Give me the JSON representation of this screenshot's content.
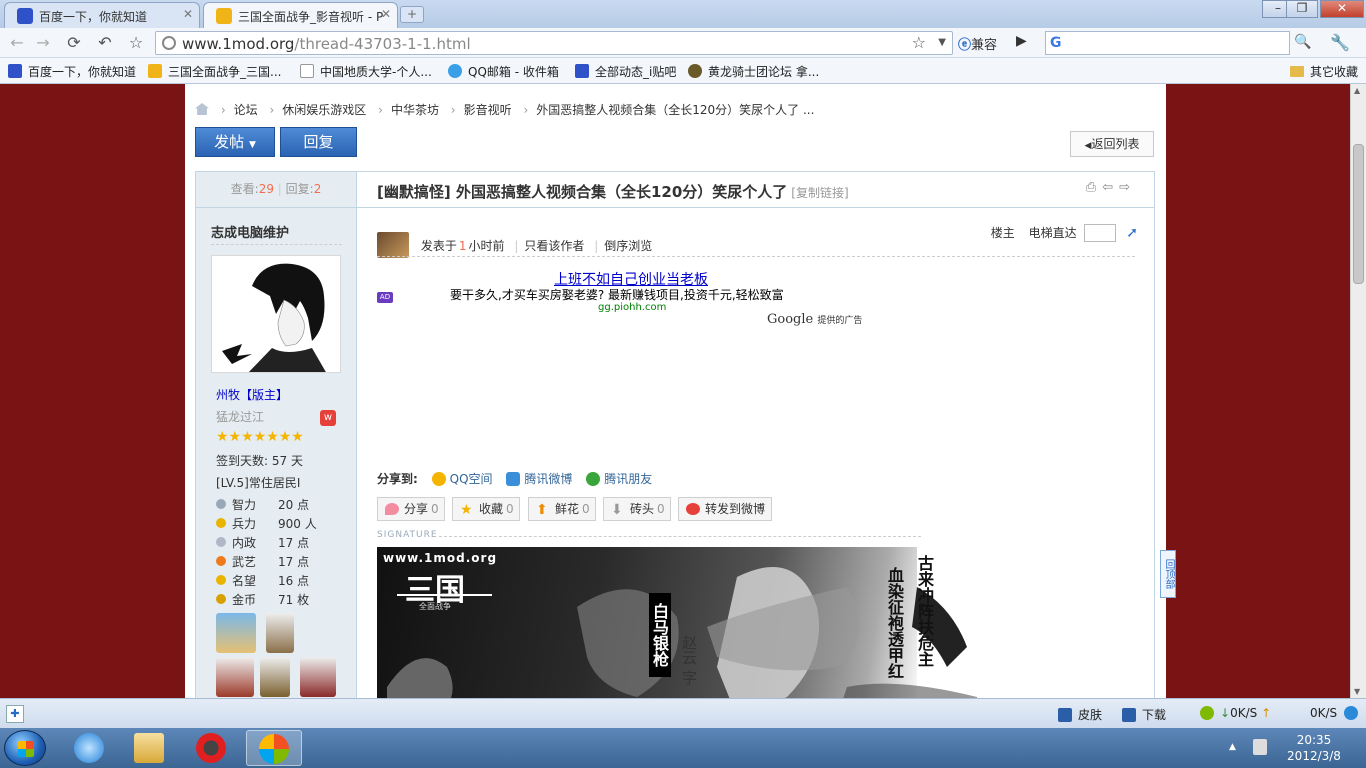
{
  "browser": {
    "tabs": [
      {
        "title": "百度一下，你就知道",
        "active": false
      },
      {
        "title": "三国全面战争_影音视听 - P",
        "active": true
      }
    ],
    "url_host": "www.1mod.org",
    "url_path": "/thread-43703-1-1.html",
    "compat_label": "兼容",
    "bookmarks": [
      "百度一下，你就知道",
      "三国全面战争_三国...",
      "中国地质大学-个人...",
      "QQ邮箱 - 收件箱",
      "全部动态_i贴吧",
      "黄龙骑士团论坛 拿..."
    ],
    "other_bookmarks": "其它收藏"
  },
  "breadcrumb": [
    "论坛",
    "休闲娱乐游戏区",
    "中华茶坊",
    "影音视听",
    "外国恶搞整人视频合集（全长120分）笑尿个人了 ..."
  ],
  "toolbar": {
    "post_label": "发帖",
    "reply_label": "回复",
    "back_label": "返回列表"
  },
  "thread": {
    "views_label": "查看:",
    "views": "29",
    "replies_label": "回复:",
    "replies": "2",
    "category": "[幽默搞怪]",
    "title": "外国恶搞整人视频合集（全长120分）笑尿个人了",
    "copy_link": "[复制链接]"
  },
  "author": {
    "name": "志成电脑维护",
    "role": "州牧【版主】",
    "motto": "猛龙过江",
    "stars": "★★★★★★★",
    "sign_days": "签到天数: 57 天",
    "level": "[LV.5]常住居民I",
    "attributes": [
      {
        "name": "智力",
        "value": "20 点",
        "color": "#9aa7b8"
      },
      {
        "name": "兵力",
        "value": "900 人",
        "color": "#e8b400"
      },
      {
        "name": "内政",
        "value": "17 点",
        "color": "#b0b8c8"
      },
      {
        "name": "武艺",
        "value": "17 点",
        "color": "#ef7a1a"
      },
      {
        "name": "名望",
        "value": "16 点",
        "color": "#e8b400"
      },
      {
        "name": "金币",
        "value": "71 枚",
        "color": "#d8a000"
      }
    ]
  },
  "post_meta": {
    "posted_prefix": "发表于",
    "posted_num": "1",
    "posted_suffix": "小时前",
    "only_author": "只看该作者",
    "reverse": "倒序浏览",
    "owner": "楼主",
    "elevator": "电梯直达"
  },
  "ad": {
    "title": "上班不如自己创业当老板",
    "badge": "AD",
    "desc": "要干多久,才买车买房娶老婆? 最新赚钱项目,投资千元,轻松致富",
    "url": "gg.piohh.com",
    "provider": "Google",
    "provider_suffix": "提供的广告"
  },
  "share": {
    "label": "分享到:",
    "items": [
      "QQ空间",
      "腾讯微博",
      "腾讯朋友"
    ]
  },
  "actions": [
    {
      "label": "分享",
      "count": "0"
    },
    {
      "label": "收藏",
      "count": "0"
    },
    {
      "label": "鲜花",
      "count": "0"
    },
    {
      "label": "砖头",
      "count": "0"
    },
    {
      "label": "转发到微博",
      "count": ""
    }
  ],
  "signature": {
    "label": "SIGNATURE",
    "site": "www.1mod.org",
    "logo_main": "三国",
    "logo_sub": "全面战争",
    "vertical_box": "白马银枪",
    "hero_name": "赵云 字",
    "poem_line1": "血染征袍透甲红",
    "poem_line2": "古来冲阵扶危主"
  },
  "to_top": "回顶部",
  "statusbar": {
    "skin": "皮肤",
    "download": "下载",
    "speed_down": "0K/S",
    "speed_up": "0K/S"
  },
  "clock": {
    "time": "20:35",
    "date": "2012/3/8"
  }
}
